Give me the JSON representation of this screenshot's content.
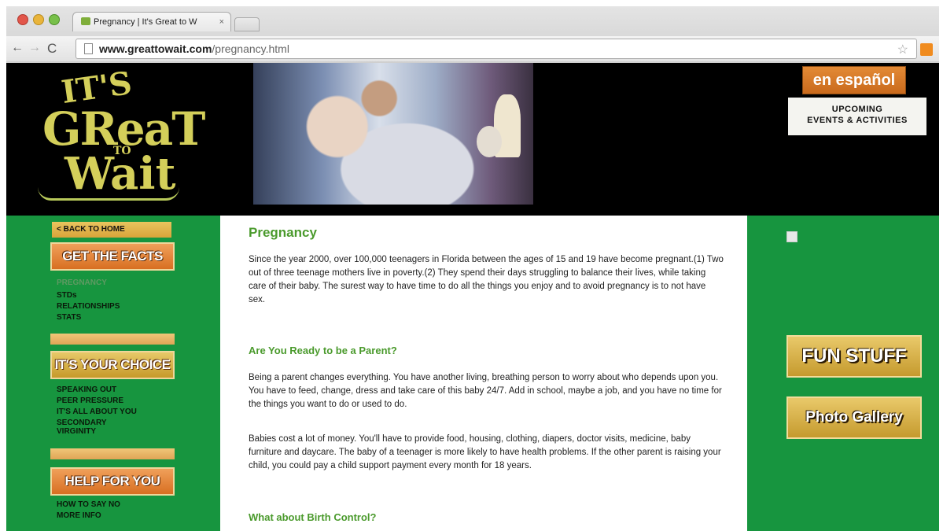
{
  "browser": {
    "tab_title": "Pregnancy | It's Great to W",
    "tab_close": "×",
    "url_domain": "www.greattowait.com",
    "url_path": "/pregnancy.html",
    "back_icon": "←",
    "forward_icon": "→",
    "reload_icon": "C",
    "star_icon": "☆"
  },
  "header": {
    "logo": {
      "l1": "IT'S",
      "l2": "GReaT",
      "l3": "TO",
      "l4": "Wait"
    },
    "espanol": "en español",
    "upcoming_line1": "UPCOMING",
    "upcoming_line2": "EVENTS & ACTIVITIES"
  },
  "sidebar": {
    "back_home": "< BACK TO HOME",
    "sections": [
      {
        "title": "GET THE FACTS",
        "links": [
          "PREGNANCY",
          "STDs",
          "RELATIONSHIPS",
          "STATS"
        ]
      },
      {
        "title": "IT'S YOUR CHOICE",
        "links": [
          "SPEAKING OUT",
          "PEER PRESSURE",
          "IT'S ALL ABOUT YOU",
          "SECONDARY VIRGINITY"
        ]
      },
      {
        "title": "HELP FOR YOU",
        "links": [
          "HOW TO SAY NO",
          "MORE INFO"
        ]
      }
    ]
  },
  "main": {
    "title": "Pregnancy",
    "intro": "Since the year 2000, over 100,000 teenagers in Florida between the ages of 15 and 19 have become pregnant.(1) Two out of three teenage mothers live in poverty.(2) They spend their days struggling to balance their lives, while taking care of their baby. The surest way to have time to do all the things you enjoy and to avoid pregnancy is to not have sex.",
    "h_ready": "Are You Ready to be a Parent?",
    "p_ready1": "Being a parent changes everything. You have another living, breathing person to worry about who depends upon you. You have to feed, change, dress and take care of this baby 24/7. Add in school, maybe a job, and you have no time for the things you want to do or used to do.",
    "p_ready2": "Babies cost a lot of money. You'll have to provide food, housing, clothing, diapers, doctor visits, medicine, baby furniture and daycare. The baby of a teenager is more likely to have health problems. If the other parent is raising your child, you could pay a child support payment every month for 18 years.",
    "h_birth": "What about Birth Control?"
  },
  "right_panel": {
    "fun_stuff": "FUN STUFF",
    "photo_gallery": "Photo Gallery"
  }
}
